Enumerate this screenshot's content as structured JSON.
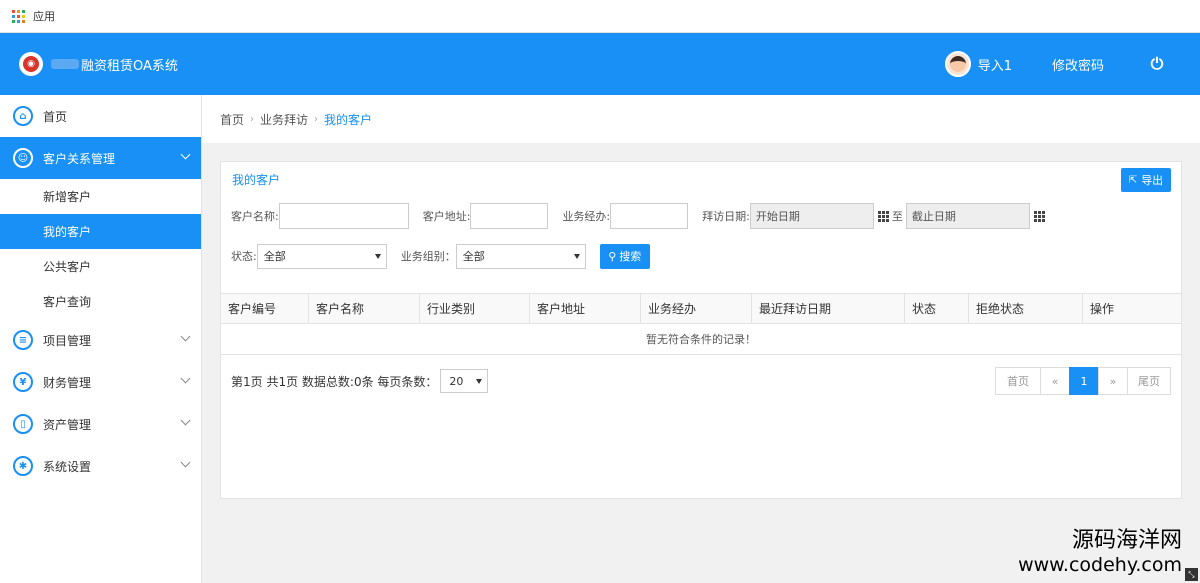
{
  "bookmarks": {
    "apps_label": "应用"
  },
  "header": {
    "system_title": "融资租赁OA系统",
    "user_name": "导入1",
    "change_password": "修改密码"
  },
  "sidebar": {
    "items": [
      {
        "label": "首页",
        "icon": "home-icon"
      },
      {
        "label": "客户关系管理",
        "icon": "users-icon",
        "active": true
      },
      {
        "label": "项目管理",
        "icon": "list-icon"
      },
      {
        "label": "财务管理",
        "icon": "yen-icon"
      },
      {
        "label": "资产管理",
        "icon": "file-icon"
      },
      {
        "label": "系统设置",
        "icon": "gear-icon"
      }
    ],
    "sub_items": [
      {
        "label": "新增客户"
      },
      {
        "label": "我的客户",
        "active": true
      },
      {
        "label": "公共客户"
      },
      {
        "label": "客户查询"
      }
    ]
  },
  "breadcrumb": {
    "home": "首页",
    "section": "业务拜访",
    "current": "我的客户"
  },
  "panel": {
    "title": "我的客户",
    "export_label": "导出",
    "filters": {
      "customer_name_label": "客户名称:",
      "customer_address_label": "客户地址:",
      "manager_label": "业务经办:",
      "visit_date_label": "拜访日期:",
      "start_date_placeholder": "开始日期",
      "to_label": "至",
      "end_date_placeholder": "截止日期",
      "status_label": "状态:",
      "status_value": "全部",
      "group_label": "业务组别：",
      "group_value": "全部",
      "search_label": "搜索"
    },
    "table": {
      "columns": [
        "客户编号",
        "客户名称",
        "行业类别",
        "客户地址",
        "业务经办",
        "最近拜访日期",
        "状态",
        "拒绝状态",
        "操作"
      ],
      "empty_text": "暂无符合条件的记录！"
    },
    "footer": {
      "page_info": "第1页 共1页 数据总数:0条 每页条数：",
      "page_size": "20",
      "first": "首页",
      "prev": "«",
      "current": "1",
      "next": "»",
      "last": "尾页"
    }
  },
  "watermark": {
    "line1": "源码海洋网",
    "line2": "www.codehy.com"
  },
  "colors": {
    "primary": "#1890f5",
    "logo_red": "#d9342b"
  }
}
